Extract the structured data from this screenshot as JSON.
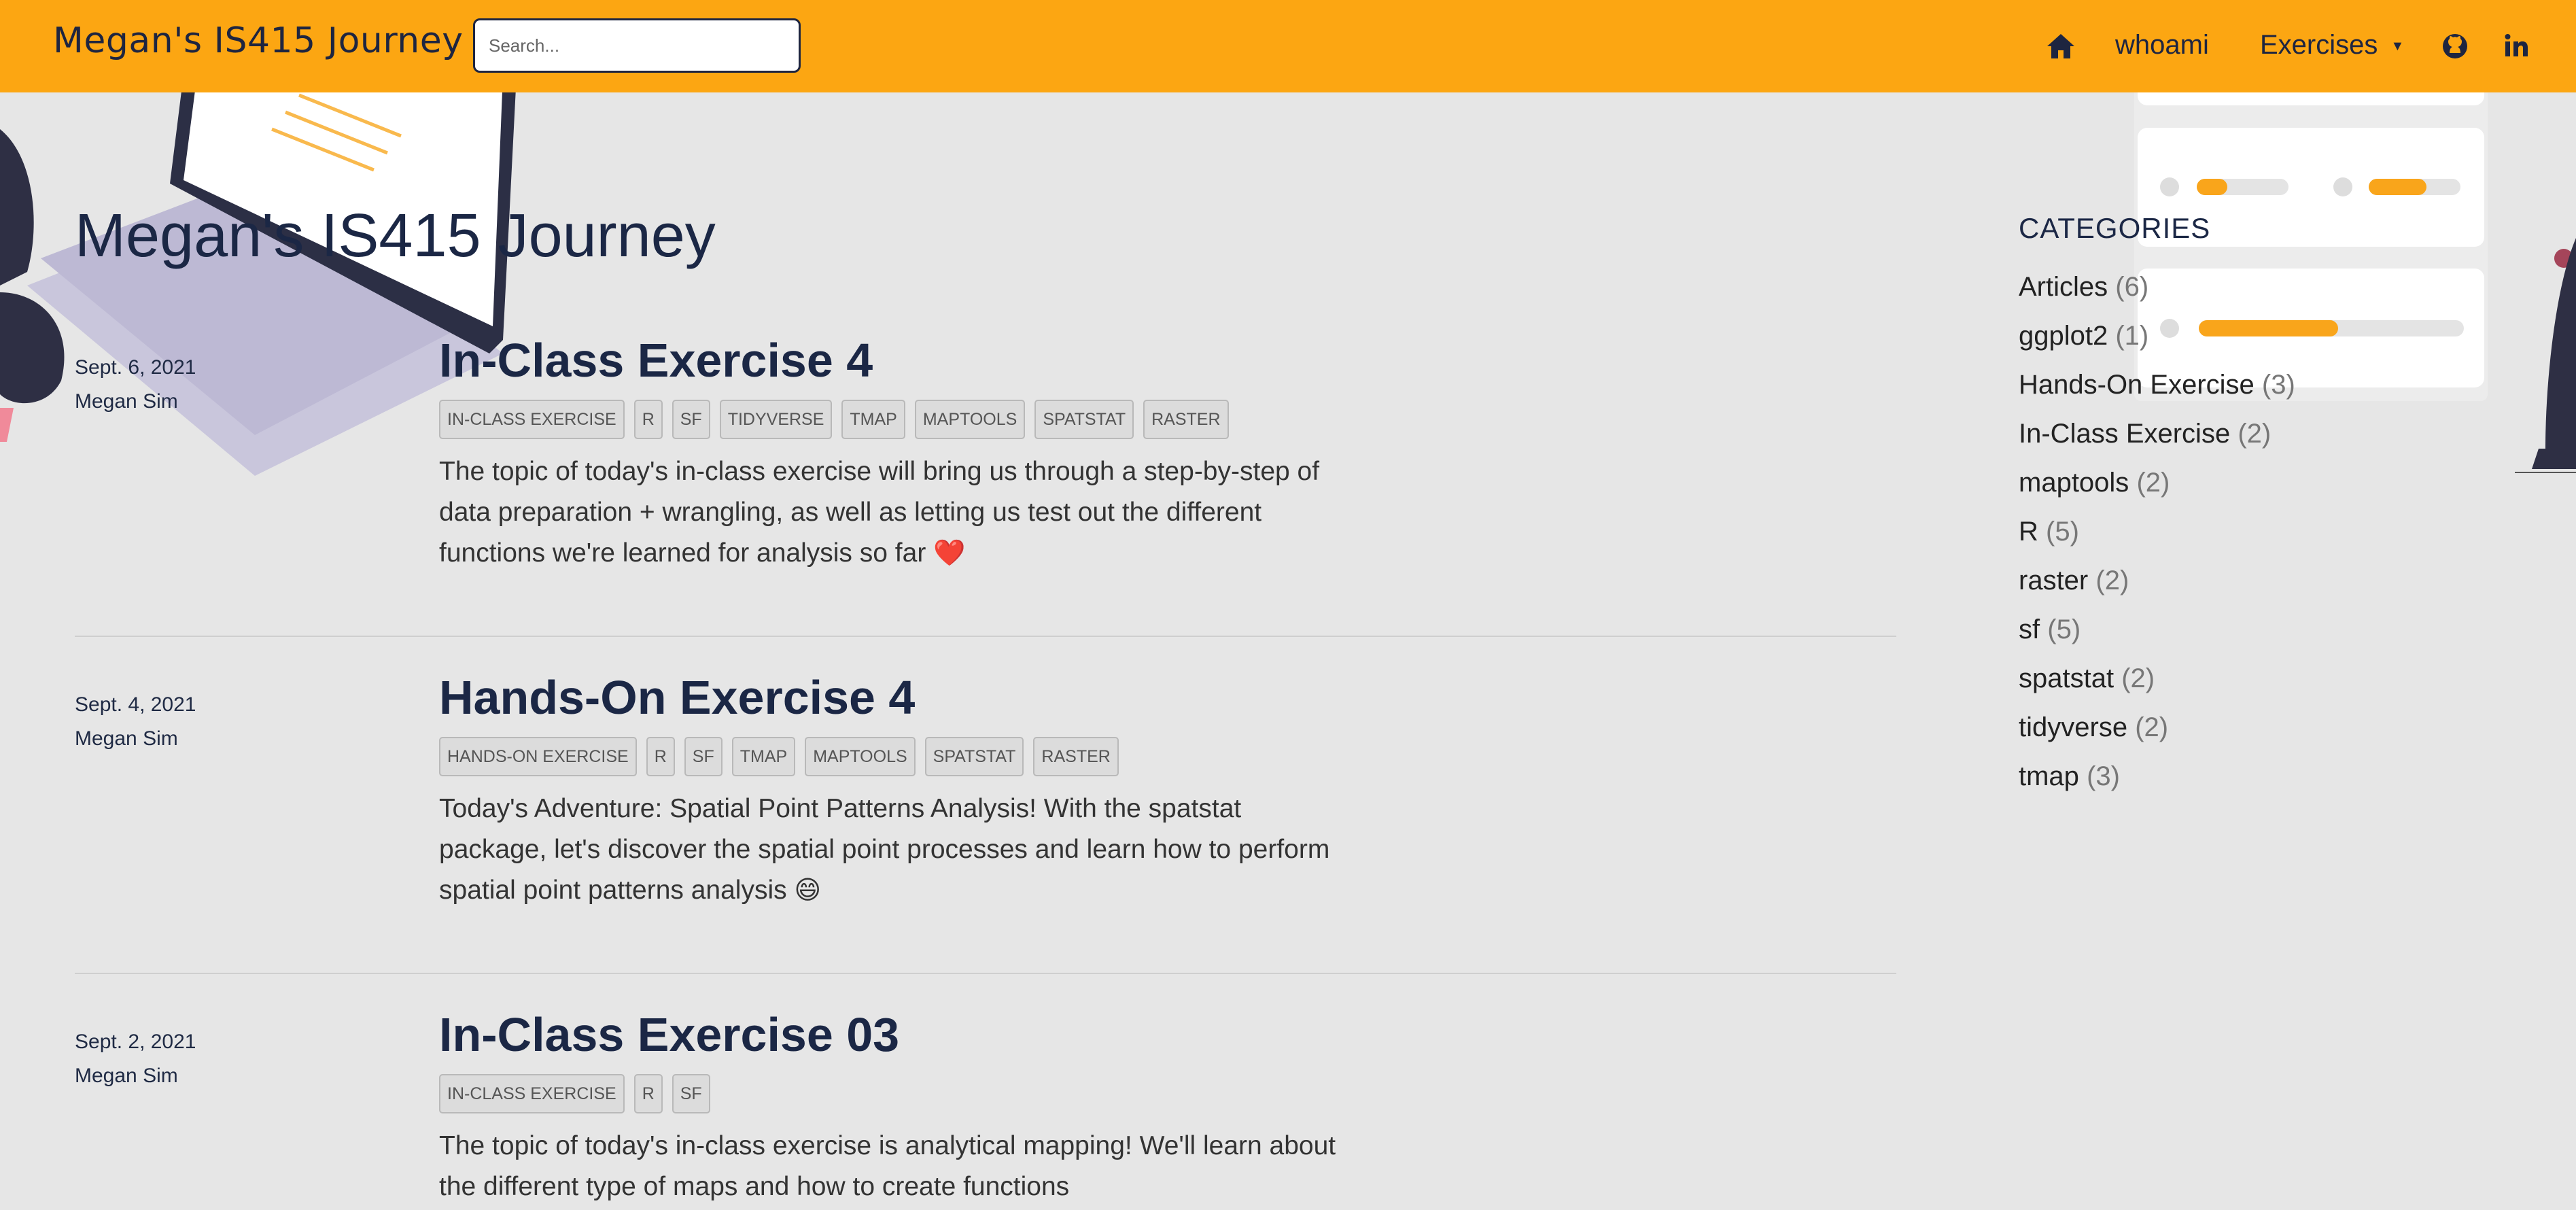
{
  "navbar": {
    "brand": "Megan's IS415 Journey",
    "search_placeholder": "Search...",
    "whoami": "whoami",
    "exercises": "Exercises",
    "exercises_caret": "▼"
  },
  "page_title": "Megan's IS415 Journey",
  "posts": [
    {
      "date": "Sept. 6, 2021",
      "author": "Megan Sim",
      "title": "In-Class Exercise 4",
      "tags": [
        "IN-CLASS EXERCISE",
        "R",
        "SF",
        "TIDYVERSE",
        "TMAP",
        "MAPTOOLS",
        "SPATSTAT",
        "RASTER"
      ],
      "description": "The topic of today's in-class exercise will bring us through a step-by-step of data preparation + wrangling, as well as letting us test out the different functions we're learned for analysis so far",
      "emoji": "❤️"
    },
    {
      "date": "Sept. 4, 2021",
      "author": "Megan Sim",
      "title": "Hands-On Exercise 4",
      "tags": [
        "HANDS-ON EXERCISE",
        "R",
        "SF",
        "TMAP",
        "MAPTOOLS",
        "SPATSTAT",
        "RASTER"
      ],
      "description": "Today's Adventure: Spatial Point Patterns Analysis! With the spatstat package, let's discover the spatial point processes and learn how to perform spatial point patterns analysis",
      "emoji": "😄"
    },
    {
      "date": "Sept. 2, 2021",
      "author": "Megan Sim",
      "title": "In-Class Exercise 03",
      "tags": [
        "IN-CLASS EXERCISE",
        "R",
        "SF"
      ],
      "description": "The topic of today's in-class exercise is analytical mapping! We'll learn about the different type of maps and how to create functions",
      "emoji": ""
    }
  ],
  "sidebar": {
    "heading": "CATEGORIES",
    "categories": [
      {
        "name": "Articles",
        "count": "(6)"
      },
      {
        "name": "ggplot2",
        "count": "(1)"
      },
      {
        "name": "Hands-On Exercise",
        "count": "(3)"
      },
      {
        "name": "In-Class Exercise",
        "count": "(2)"
      },
      {
        "name": "maptools",
        "count": "(2)"
      },
      {
        "name": "R",
        "count": "(5)"
      },
      {
        "name": "raster",
        "count": "(2)"
      },
      {
        "name": "sf",
        "count": "(5)"
      },
      {
        "name": "spatstat",
        "count": "(2)"
      },
      {
        "name": "tidyverse",
        "count": "(2)"
      },
      {
        "name": "tmap",
        "count": "(3)"
      }
    ]
  },
  "colors": {
    "navbar": "#fca612",
    "background": "#e6e6e6",
    "text_dark": "#1b2745",
    "accent": "#f9a51b"
  }
}
